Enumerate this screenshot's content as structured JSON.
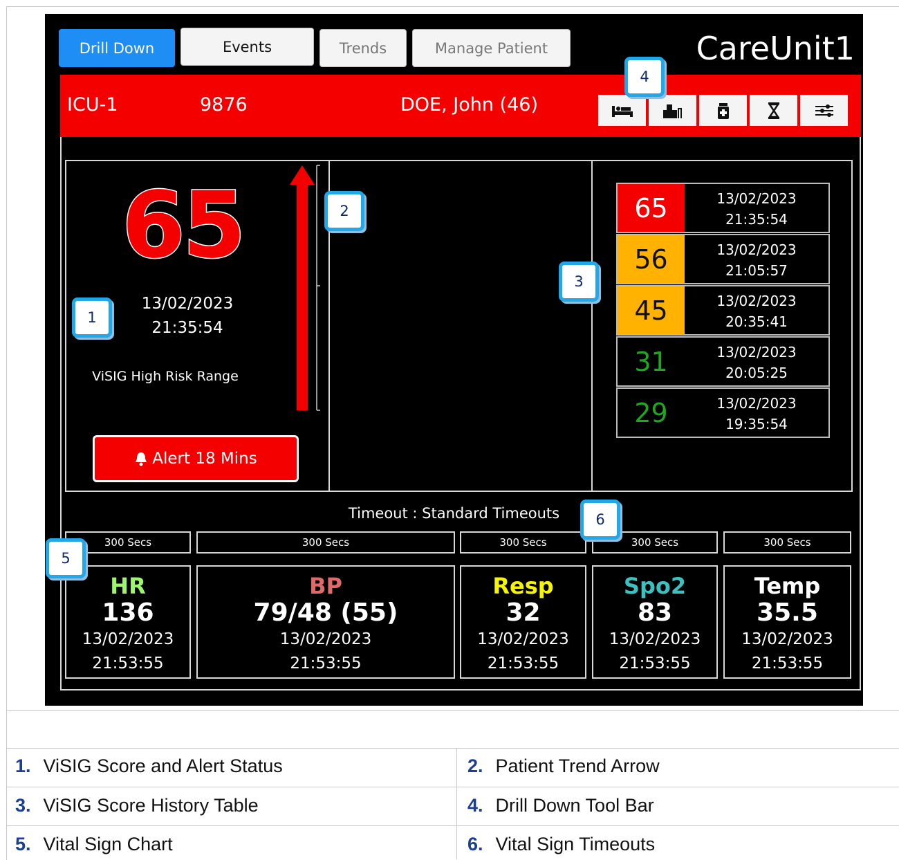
{
  "tabs": [
    {
      "label": "Drill Down",
      "state": "active"
    },
    {
      "label": "Events",
      "state": "normal"
    },
    {
      "label": "Trends",
      "state": "normal"
    },
    {
      "label": "Manage Patient",
      "state": "normal"
    }
  ],
  "app_name": "CareUnit1",
  "patient": {
    "unit": "ICU-1",
    "id": "9876",
    "name": "DOE, John (46)"
  },
  "toolbar": {
    "icons": [
      "bed-icon",
      "person-seated-icon",
      "medication-icon",
      "hourglass-icon",
      "settings-sliders-icon"
    ]
  },
  "score": {
    "value": "65",
    "date": "13/02/2023",
    "time": "21:35:54",
    "range_label": "ViSIG High Risk Range",
    "alert_label": "Alert 18 Mins"
  },
  "trend": {
    "direction": "up",
    "color": "#f40000"
  },
  "history": [
    {
      "score": "65",
      "date": "13/02/2023",
      "time": "21:35:54",
      "bg": "#f40000",
      "fg": "#ffffff"
    },
    {
      "score": "56",
      "date": "13/02/2023",
      "time": "21:05:57",
      "bg": "#ffb300",
      "fg": "#111111"
    },
    {
      "score": "45",
      "date": "13/02/2023",
      "time": "20:35:41",
      "bg": "#ffb300",
      "fg": "#111111"
    },
    {
      "score": "31",
      "date": "13/02/2023",
      "time": "20:05:25",
      "bg": "#000000",
      "fg": "#1fa81f"
    },
    {
      "score": "29",
      "date": "13/02/2023",
      "time": "19:35:54",
      "bg": "#000000",
      "fg": "#1fa81f"
    }
  ],
  "timeout_title": "Timeout : Standard Timeouts",
  "vitals": [
    {
      "timeout": "300 Secs",
      "name": "HR",
      "value": "136",
      "date": "13/02/2023",
      "time": "21:53:55",
      "color": "#9cf56a"
    },
    {
      "timeout": "300 Secs",
      "name": "BP",
      "value": "79/48 (55)",
      "date": "13/02/2023",
      "time": "21:53:55",
      "color": "#e06a6a"
    },
    {
      "timeout": "300 Secs",
      "name": "Resp",
      "value": "32",
      "date": "13/02/2023",
      "time": "21:53:55",
      "color": "#f5f500"
    },
    {
      "timeout": "300 Secs",
      "name": "Spo2",
      "value": "83",
      "date": "13/02/2023",
      "time": "21:53:55",
      "color": "#3cc0c0"
    },
    {
      "timeout": "300 Secs",
      "name": "Temp",
      "value": "35.5",
      "date": "13/02/2023",
      "time": "21:53:55",
      "color": "#ffffff"
    }
  ],
  "callouts": [
    "1",
    "2",
    "3",
    "4",
    "5",
    "6"
  ],
  "legend": [
    {
      "num": "1.",
      "text": "ViSIG Score and Alert Status"
    },
    {
      "num": "2.",
      "text": "Patient Trend Arrow"
    },
    {
      "num": "3.",
      "text": "ViSIG Score History Table"
    },
    {
      "num": "4.",
      "text": "Drill Down Tool Bar"
    },
    {
      "num": "5.",
      "text": "Vital Sign Chart"
    },
    {
      "num": "6.",
      "text": "Vital Sign Timeouts"
    }
  ]
}
